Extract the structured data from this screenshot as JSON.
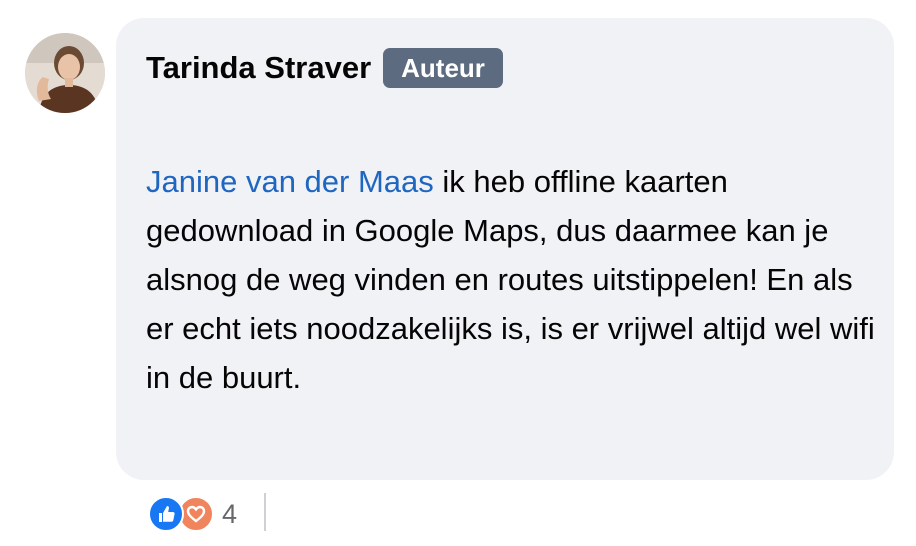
{
  "comment": {
    "author_name": "Tarinda Straver",
    "author_badge": "Auteur",
    "mention": "Janine van der Maas",
    "text": " ik heb offline kaarten gedownload in Google Maps, dus daarmee kan je alsnog de weg vinden en routes uitstippelen! En als er echt iets noodzakelijks is, is er vrijwel altijd wel wifi in de buurt."
  },
  "reactions": {
    "icons": [
      "like-icon",
      "love-icon"
    ],
    "count": "4"
  },
  "colors": {
    "bubble_bg": "#f0f2f5",
    "badge_bg": "#5c6b80",
    "mention": "#1f66c1",
    "like": "#1877f2",
    "love": "#f0845c"
  }
}
